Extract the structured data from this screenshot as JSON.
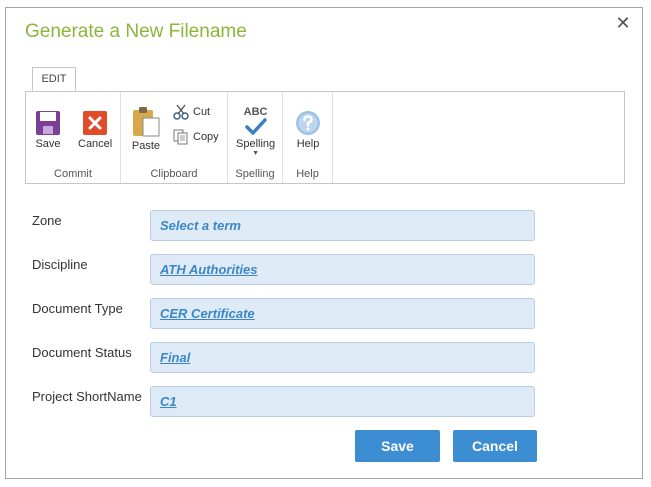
{
  "dialog": {
    "title": "Generate a New Filename",
    "close_symbol": "✕"
  },
  "ribbon": {
    "tab": "EDIT",
    "groups": {
      "commit": {
        "label": "Commit",
        "save": "Save",
        "cancel": "Cancel"
      },
      "clipboard": {
        "label": "Clipboard",
        "paste": "Paste",
        "cut": "Cut",
        "copy": "Copy"
      },
      "spelling": {
        "label": "Spelling",
        "button": "Spelling",
        "abc": "ABC"
      },
      "help": {
        "label": "Help",
        "button": "Help"
      }
    }
  },
  "fields": [
    {
      "label": "Zone",
      "value": "Select a term"
    },
    {
      "label": "Discipline",
      "value": "ATH Authorities"
    },
    {
      "label": "Document Type",
      "value": "CER Certificate"
    },
    {
      "label": "Document Status",
      "value": "Final"
    },
    {
      "label": "Project ShortName",
      "value": "C1"
    }
  ],
  "actions": {
    "save": "Save",
    "cancel": "Cancel"
  },
  "colors": {
    "title": "#8cb53a",
    "field_bg": "#deebf7",
    "field_text": "#3c87c6",
    "button": "#3c8dd2"
  },
  "icons": {
    "save": "floppy-disk-icon",
    "cancel": "cancel-x-icon",
    "paste": "clipboard-paste-icon",
    "cut": "scissors-icon",
    "copy": "copy-icon",
    "spelling": "spell-check-icon",
    "help": "help-question-icon"
  }
}
